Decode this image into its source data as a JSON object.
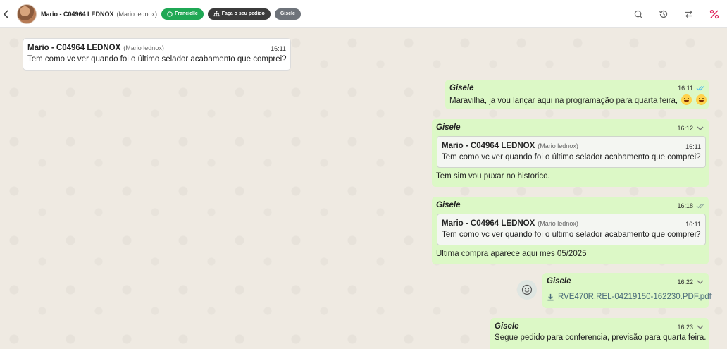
{
  "header": {
    "contact_name": "Mario - C04964 LEDNOX",
    "contact_sub": "(Mario lednox)",
    "chips": {
      "agent": "Francielle",
      "order": "Faça o seu pedido",
      "user": "Gisele"
    },
    "icons": [
      "search-icon",
      "history-icon",
      "transfer-icon",
      "percent-icon"
    ]
  },
  "messages": {
    "m1": {
      "sender": "Mario - C04964 LEDNOX",
      "sender_sub": "(Mario lednox)",
      "time": "16:11",
      "text": "Tem como vc ver quando foi o último selador acabamento que comprei?"
    },
    "m2": {
      "sender": "Gisele",
      "time": "16:11",
      "text": "Maravilha, ja vou lançar aqui na programação para quarta feira,"
    },
    "m3": {
      "sender": "Gisele",
      "time": "16:12",
      "quote_sender": "Mario - C04964 LEDNOX",
      "quote_sub": "(Mario lednox)",
      "quote_time": "16:11",
      "quote_text": "Tem como vc ver quando foi o último selador acabamento que comprei?",
      "text": "Tem sim vou puxar no historico."
    },
    "m4": {
      "sender": "Gisele",
      "time": "16:18",
      "quote_sender": "Mario - C04964 LEDNOX",
      "quote_sub": "(Mario lednox)",
      "quote_time": "16:11",
      "quote_text": "Tem como vc ver quando foi o último selador acabamento que comprei?",
      "text": "Ultima compra aparece aqui mes 05/2025"
    },
    "m5": {
      "sender": "Gisele",
      "time": "16:22",
      "file_name": "RVE470R.REL-04219150-162230.PDF.pdf"
    },
    "m6": {
      "sender": "Gisele",
      "time": "16:23",
      "text": "Segue pedido para conferencia, previsão para quarta feira."
    }
  },
  "colors": {
    "outgoing_bubble": "#dcf8c6",
    "incoming_bubble": "#ffffff",
    "chip_green": "#1fa855",
    "percent_icon": "#e0245e",
    "read_ticks": "#53bdeb"
  }
}
